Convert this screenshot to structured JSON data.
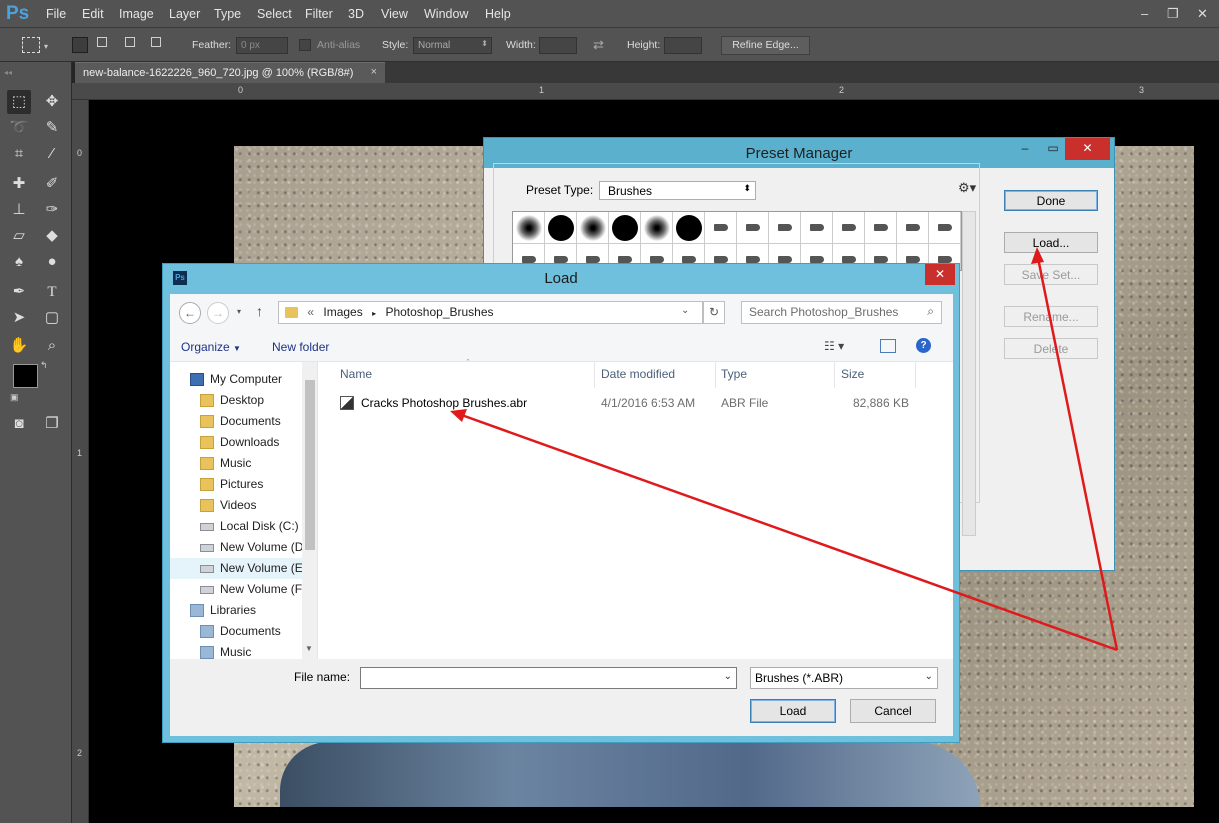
{
  "app": {
    "logo": "Ps"
  },
  "menu": [
    "File",
    "Edit",
    "Image",
    "Layer",
    "Type",
    "Select",
    "Filter",
    "3D",
    "View",
    "Window",
    "Help"
  ],
  "window_controls": [
    "–",
    "❐",
    "✕"
  ],
  "options_bar": {
    "feather_label": "Feather:",
    "feather_value": "0 px",
    "antialias_label": "Anti-alias",
    "style_label": "Style:",
    "style_value": "Normal",
    "width_label": "Width:",
    "height_label": "Height:",
    "refine_edge": "Refine Edge..."
  },
  "document_tab": {
    "title": "new-balance-1622226_960_720.jpg @ 100% (RGB/8#)",
    "close": "×"
  },
  "rulers": {
    "h": [
      "0",
      "1",
      "2",
      "3"
    ],
    "v": [
      "0",
      "1",
      "2"
    ]
  },
  "preset_manager": {
    "title": "Preset Manager",
    "preset_type_label": "Preset Type:",
    "preset_type_value": "Brushes",
    "buttons": {
      "done": "Done",
      "load": "Load...",
      "save_set": "Save Set...",
      "rename": "Rename...",
      "delete": "Delete"
    }
  },
  "load_dialog": {
    "title": "Load",
    "breadcrumb": [
      "«",
      "Images",
      "Photoshop_Brushes"
    ],
    "search_placeholder": "Search Photoshop_Brushes",
    "organize": "Organize",
    "new_folder": "New folder",
    "tree": [
      {
        "label": "My Computer",
        "icon": "computer-icon",
        "level": 0
      },
      {
        "label": "Desktop",
        "icon": "folder-icon",
        "level": 1
      },
      {
        "label": "Documents",
        "icon": "folder-icon",
        "level": 1
      },
      {
        "label": "Downloads",
        "icon": "folder-icon",
        "level": 1
      },
      {
        "label": "Music",
        "icon": "folder-icon",
        "level": 1
      },
      {
        "label": "Pictures",
        "icon": "folder-icon",
        "level": 1
      },
      {
        "label": "Videos",
        "icon": "folder-icon",
        "level": 1
      },
      {
        "label": "Local Disk (C:)",
        "icon": "drive-icon",
        "level": 1
      },
      {
        "label": "New Volume (D",
        "icon": "drive-icon",
        "level": 1
      },
      {
        "label": "New Volume (E",
        "icon": "drive-icon",
        "level": 1
      },
      {
        "label": "New Volume (F",
        "icon": "drive-icon",
        "level": 1
      },
      {
        "label": "Libraries",
        "icon": "library-icon",
        "level": 0
      },
      {
        "label": "Documents",
        "icon": "library-icon",
        "level": 1
      },
      {
        "label": "Music",
        "icon": "library-icon",
        "level": 1
      }
    ],
    "columns": [
      "Name",
      "Date modified",
      "Type",
      "Size"
    ],
    "files": [
      {
        "name": "Cracks Photoshop Brushes.abr",
        "date": "4/1/2016 6:53 AM",
        "type": "ABR File",
        "size": "82,886 KB"
      }
    ],
    "file_name_label": "File name:",
    "file_name_value": "",
    "file_type_value": "Brushes (*.ABR)",
    "load_button": "Load",
    "cancel_button": "Cancel"
  },
  "colors": {
    "accent": "#5bb1cd",
    "annotation": "#e0191b",
    "ps_blue": "#4aa3df"
  }
}
